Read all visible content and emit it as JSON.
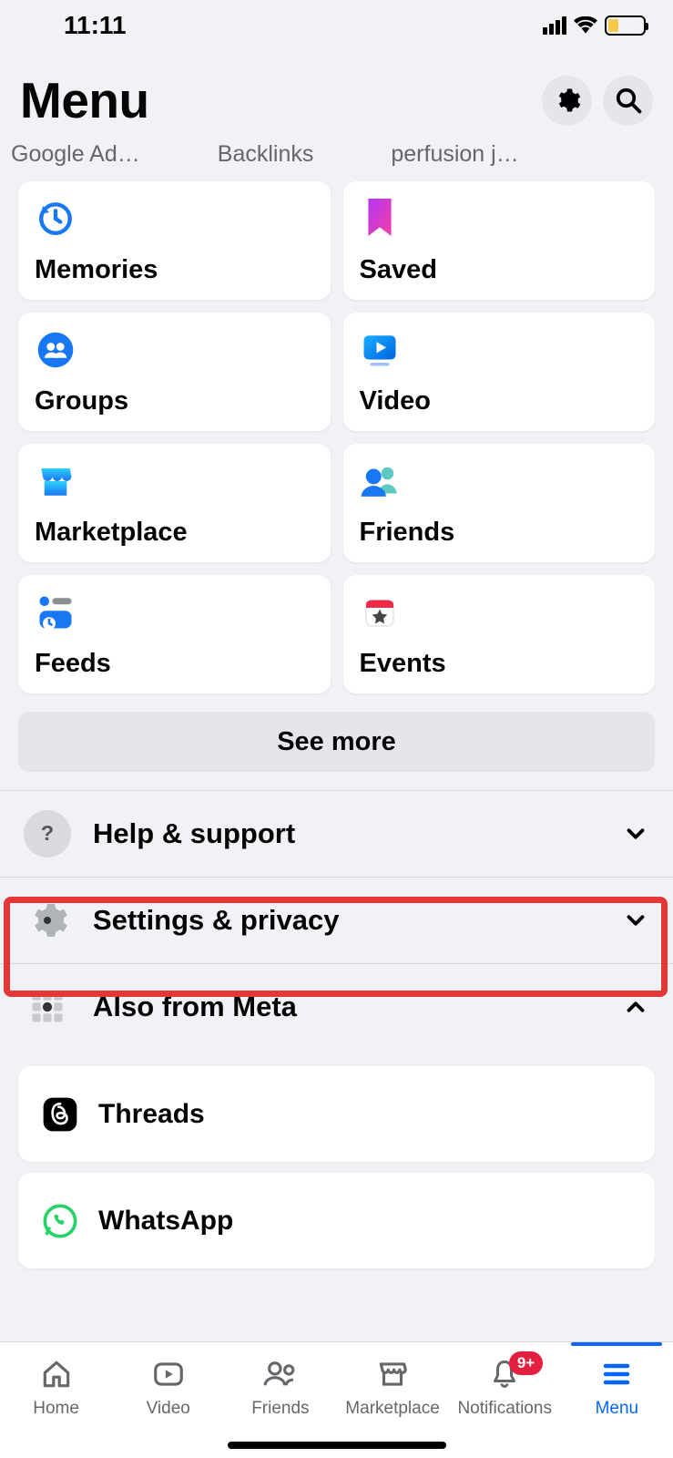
{
  "status": {
    "time": "11:11"
  },
  "header": {
    "title": "Menu"
  },
  "shortcuts": [
    "Google Ad…",
    "Backlinks",
    "perfusion j…"
  ],
  "tiles": [
    {
      "label": "Memories"
    },
    {
      "label": "Saved"
    },
    {
      "label": "Groups"
    },
    {
      "label": "Video"
    },
    {
      "label": "Marketplace"
    },
    {
      "label": "Friends"
    },
    {
      "label": "Feeds"
    },
    {
      "label": "Events"
    }
  ],
  "see_more": "See more",
  "sections": {
    "help": {
      "label": "Help & support",
      "expanded": false
    },
    "settings": {
      "label": "Settings & privacy",
      "expanded": false
    },
    "meta": {
      "label": "Also from Meta",
      "expanded": true
    }
  },
  "meta_apps": [
    {
      "name": "Threads"
    },
    {
      "name": "WhatsApp"
    }
  ],
  "tabs": [
    {
      "label": "Home"
    },
    {
      "label": "Video"
    },
    {
      "label": "Friends"
    },
    {
      "label": "Marketplace"
    },
    {
      "label": "Notifications",
      "badge": "9+"
    },
    {
      "label": "Menu",
      "active": true
    }
  ]
}
